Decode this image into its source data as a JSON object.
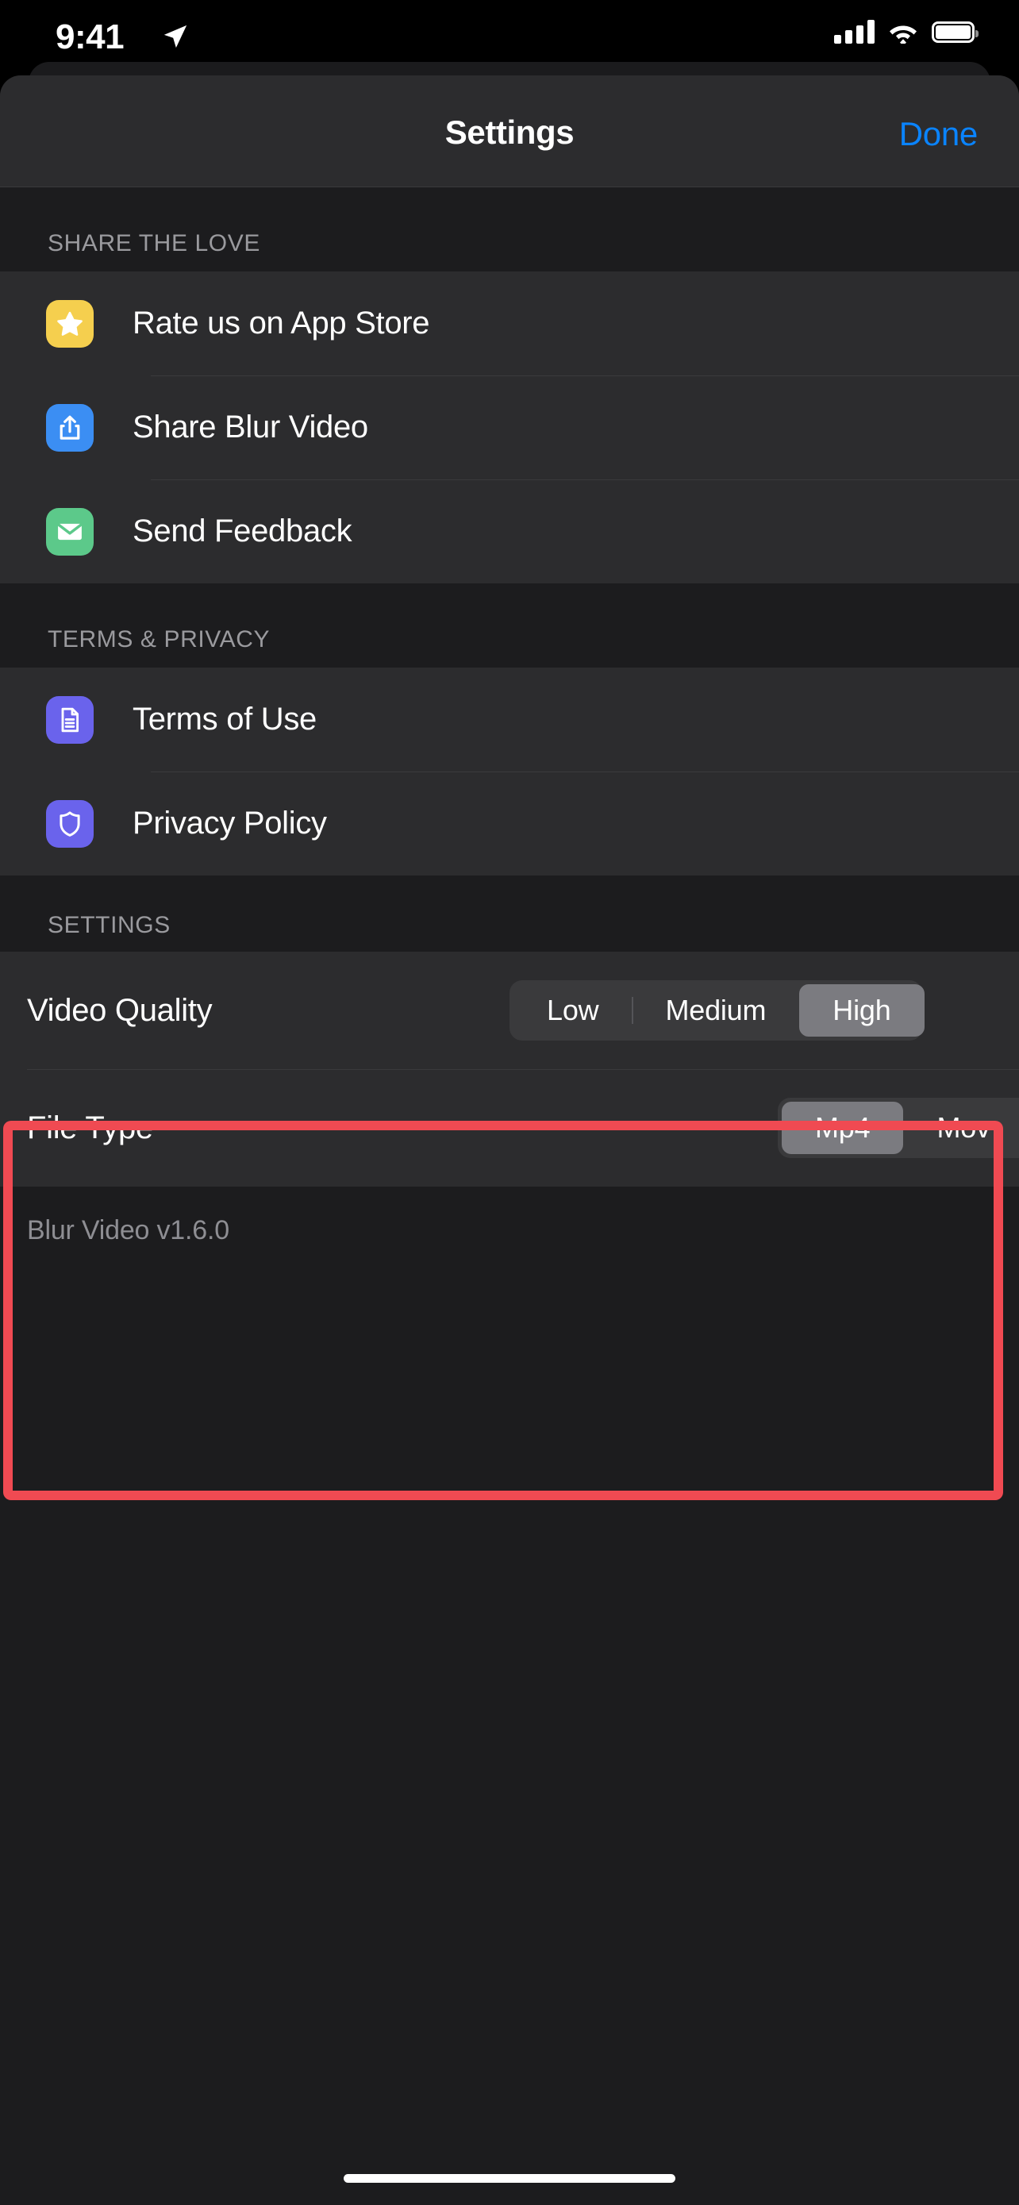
{
  "status_bar": {
    "time": "9:41",
    "location_icon": "location-arrow-icon",
    "signal_icon": "cellular-signal-icon",
    "wifi_icon": "wifi-icon",
    "battery_icon": "battery-full-icon"
  },
  "nav": {
    "title": "Settings",
    "done_label": "Done"
  },
  "sections": [
    {
      "header": "SHARE THE LOVE",
      "rows": [
        {
          "label": "Rate us on App Store",
          "icon": "star-icon",
          "icon_color": "#f5cf4e"
        },
        {
          "label": "Share Blur Video",
          "icon": "share-icon",
          "icon_color": "#3b8ef3"
        },
        {
          "label": "Send Feedback",
          "icon": "envelope-icon",
          "icon_color": "#5cc98a"
        }
      ]
    },
    {
      "header": "TERMS & PRIVACY",
      "rows": [
        {
          "label": "Terms of Use",
          "icon": "document-icon",
          "icon_color": "#6a63ec"
        },
        {
          "label": "Privacy Policy",
          "icon": "shield-icon",
          "icon_color": "#6a63ec"
        }
      ]
    }
  ],
  "settings": {
    "header": "SETTINGS",
    "video_quality": {
      "label": "Video Quality",
      "options": [
        "Low",
        "Medium",
        "High"
      ],
      "selected": "High"
    },
    "file_type": {
      "label": "File Type",
      "options": [
        "Mp4",
        "Mov"
      ],
      "selected": "Mp4"
    },
    "version": "Blur Video v1.6.0",
    "highlight_color": "#f04a52"
  }
}
